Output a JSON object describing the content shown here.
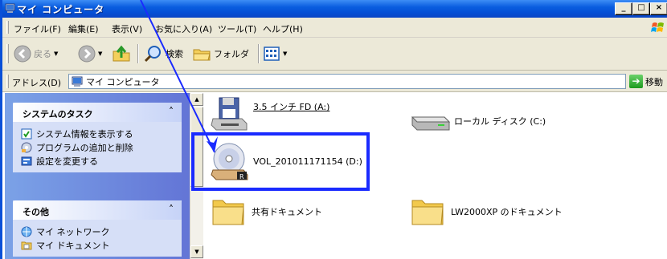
{
  "window": {
    "title": "マイ コンピュータ",
    "buttons": {
      "minimize": "_",
      "maximize": "□",
      "close": "×"
    }
  },
  "menubar": {
    "items": [
      "ファイル(F)",
      "編集(E)",
      "表示(V)",
      "お気に入り(A)",
      "ツール(T)",
      "ヘルプ(H)"
    ]
  },
  "toolbar": {
    "back": "戻る",
    "search": "検索",
    "folders": "フォルダ"
  },
  "address": {
    "label": "アドレス(D)",
    "value": "マイ コンピュータ",
    "go": "移動"
  },
  "tasks": {
    "system": {
      "title": "システムのタスク",
      "links": [
        "システム情報を表示する",
        "プログラムの追加と削除",
        "設定を変更する"
      ]
    },
    "other": {
      "title": "その他",
      "links": [
        "マイ ネットワーク",
        "マイ ドキュメント"
      ]
    }
  },
  "items": {
    "floppy": "3.5 インチ FD (A:)",
    "local_disk": "ローカル ディスク (C:)",
    "cd": "VOL_201011171154 (D:)",
    "shared_docs": "共有ドキュメント",
    "user_docs": "LW2000XP のドキュメント"
  },
  "colors": {
    "title_blue": "#0a5ddf",
    "highlight": "#1a2bff",
    "pane_blue": "#6375d6"
  }
}
